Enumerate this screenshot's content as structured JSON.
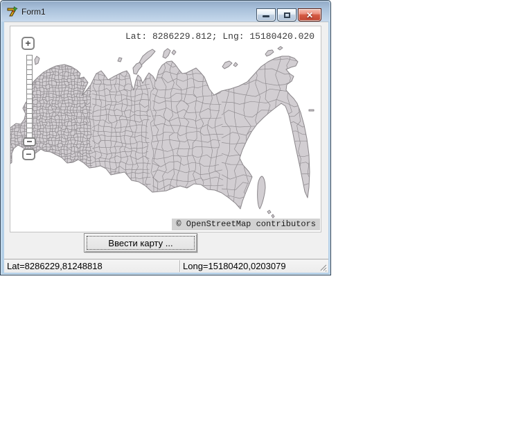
{
  "window": {
    "title": "Form1",
    "icon": "delphi-7-app-icon",
    "buttons": {
      "minimize": "minimize",
      "maximize": "maximize",
      "close": "close"
    }
  },
  "map": {
    "coord_label": "Lat: 8286229.812; Lng: 15180420.020",
    "attribution": "© OpenStreetMap contributors",
    "zoom_in_label": "+",
    "zoom_out_label": "−",
    "region": "Russia administrative boundaries"
  },
  "toolbar": {
    "enter_map_label": "Ввести карту ..."
  },
  "statusbar": {
    "lat_panel": "Lat=8286229,81248818",
    "long_panel": "Long=15180420,0203079"
  },
  "colors": {
    "frame": "#b3cfe7",
    "titlebar_top": "#93abc7",
    "titlebar_bottom": "#c6d9ec",
    "close_button_red": "#c04430",
    "client_bg": "#f0f0f0",
    "map_bg": "#ffffff",
    "land_fill": "#d2ced2",
    "land_border": "#8a868a",
    "attribution_bg": "#d2d2d2"
  }
}
